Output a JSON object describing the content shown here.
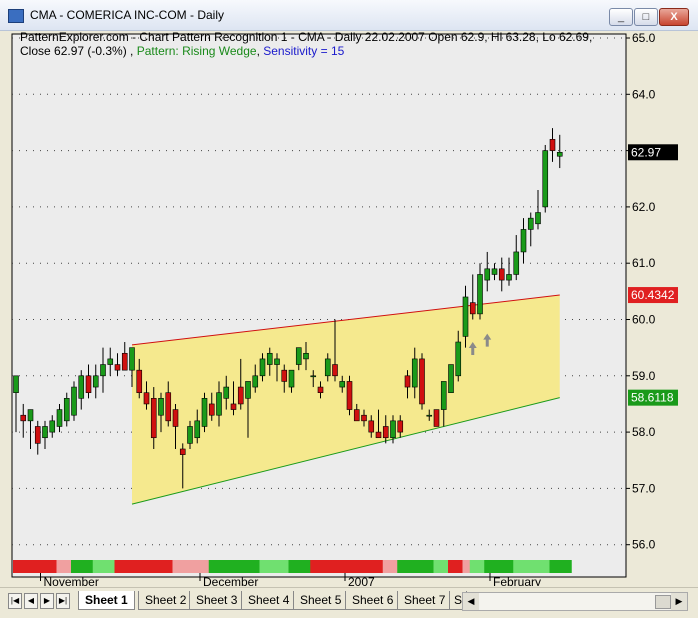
{
  "window": {
    "title": "CMA - COMERICA INC-COM - Daily",
    "min_label": "_",
    "max_label": "□",
    "close_label": "X"
  },
  "header": {
    "line1": "PatternExplorer.com - Chart Pattern Recognition 1  - CMA - Daily 22.02.2007 Open 62.9, Hi 63.28, Lo 62.69,",
    "close_text": "Close 62.97 (-0.3%) ,",
    "pattern_text": "Pattern: Rising Wedge",
    "sensitivity_text": "Sensitivity = 15"
  },
  "price_axis": {
    "labels": [
      "65.0",
      "64.0",
      "63.0",
      "62.0",
      "61.0",
      "60.0",
      "59.0",
      "58.0",
      "57.0",
      "56.0"
    ]
  },
  "value_badges": [
    {
      "text": "62.97",
      "value": 62.97,
      "bg": "#000000"
    },
    {
      "text": "60.4342",
      "value": 60.4342,
      "bg": "#e02020"
    },
    {
      "text": "58.6118",
      "value": 58.6118,
      "bg": "#1a9a1a"
    }
  ],
  "date_labels": [
    {
      "text": "November",
      "bar": 2
    },
    {
      "text": "December",
      "bar": 24
    },
    {
      "text": "2007",
      "bar": 44
    },
    {
      "text": "February",
      "bar": 64
    }
  ],
  "chart_data": {
    "type": "candlestick",
    "ylim": [
      55.8,
      65.1
    ],
    "candles": [
      {
        "o": 58.7,
        "h": 59.0,
        "l": 58.0,
        "c": 59.0
      },
      {
        "o": 58.3,
        "h": 58.5,
        "l": 57.9,
        "c": 58.2
      },
      {
        "o": 58.2,
        "h": 58.4,
        "l": 57.7,
        "c": 58.4
      },
      {
        "o": 58.1,
        "h": 58.2,
        "l": 57.6,
        "c": 57.8
      },
      {
        "o": 57.9,
        "h": 58.2,
        "l": 57.7,
        "c": 58.1
      },
      {
        "o": 58.0,
        "h": 58.3,
        "l": 57.9,
        "c": 58.2
      },
      {
        "o": 58.1,
        "h": 58.5,
        "l": 58.0,
        "c": 58.4
      },
      {
        "o": 58.2,
        "h": 58.7,
        "l": 58.1,
        "c": 58.6
      },
      {
        "o": 58.3,
        "h": 58.9,
        "l": 58.2,
        "c": 58.8
      },
      {
        "o": 58.6,
        "h": 59.1,
        "l": 58.4,
        "c": 59.0
      },
      {
        "o": 59.0,
        "h": 59.2,
        "l": 58.6,
        "c": 58.7
      },
      {
        "o": 58.8,
        "h": 59.2,
        "l": 58.6,
        "c": 59.0
      },
      {
        "o": 59.0,
        "h": 59.5,
        "l": 58.7,
        "c": 59.2
      },
      {
        "o": 59.2,
        "h": 59.5,
        "l": 59.0,
        "c": 59.3
      },
      {
        "o": 59.2,
        "h": 59.4,
        "l": 59.0,
        "c": 59.1
      },
      {
        "o": 59.4,
        "h": 59.6,
        "l": 59.1,
        "c": 59.1
      },
      {
        "o": 59.1,
        "h": 59.3,
        "l": 58.8,
        "c": 59.5
      },
      {
        "o": 59.1,
        "h": 59.3,
        "l": 58.6,
        "c": 58.7
      },
      {
        "o": 58.7,
        "h": 58.9,
        "l": 58.4,
        "c": 58.5
      },
      {
        "o": 58.6,
        "h": 58.8,
        "l": 57.7,
        "c": 57.9
      },
      {
        "o": 58.3,
        "h": 58.7,
        "l": 58.0,
        "c": 58.6
      },
      {
        "o": 58.7,
        "h": 58.9,
        "l": 58.1,
        "c": 58.2
      },
      {
        "o": 58.4,
        "h": 58.5,
        "l": 57.7,
        "c": 58.1
      },
      {
        "o": 57.7,
        "h": 57.8,
        "l": 57.0,
        "c": 57.6
      },
      {
        "o": 57.8,
        "h": 58.2,
        "l": 57.7,
        "c": 58.1
      },
      {
        "o": 57.9,
        "h": 58.4,
        "l": 57.8,
        "c": 58.2
      },
      {
        "o": 58.1,
        "h": 58.7,
        "l": 58.0,
        "c": 58.6
      },
      {
        "o": 58.5,
        "h": 58.7,
        "l": 58.2,
        "c": 58.3
      },
      {
        "o": 58.3,
        "h": 58.9,
        "l": 58.1,
        "c": 58.7
      },
      {
        "o": 58.6,
        "h": 59.0,
        "l": 58.4,
        "c": 58.8
      },
      {
        "o": 58.5,
        "h": 58.9,
        "l": 58.3,
        "c": 58.4
      },
      {
        "o": 58.8,
        "h": 59.3,
        "l": 58.4,
        "c": 58.5
      },
      {
        "o": 58.6,
        "h": 58.7,
        "l": 57.9,
        "c": 58.9
      },
      {
        "o": 58.8,
        "h": 59.2,
        "l": 58.7,
        "c": 59.0
      },
      {
        "o": 59.0,
        "h": 59.4,
        "l": 58.9,
        "c": 59.3
      },
      {
        "o": 59.2,
        "h": 59.5,
        "l": 59.0,
        "c": 59.4
      },
      {
        "o": 59.2,
        "h": 59.4,
        "l": 58.9,
        "c": 59.3
      },
      {
        "o": 59.1,
        "h": 59.2,
        "l": 58.7,
        "c": 58.9
      },
      {
        "o": 58.8,
        "h": 59.0,
        "l": 58.7,
        "c": 59.1
      },
      {
        "o": 59.2,
        "h": 59.5,
        "l": 59.1,
        "c": 59.5
      },
      {
        "o": 59.3,
        "h": 59.6,
        "l": 59.1,
        "c": 59.4
      },
      {
        "o": 59.0,
        "h": 59.1,
        "l": 58.8,
        "c": 59.0
      },
      {
        "o": 58.8,
        "h": 58.9,
        "l": 58.6,
        "c": 58.7
      },
      {
        "o": 59.0,
        "h": 59.4,
        "l": 58.9,
        "c": 59.3
      },
      {
        "o": 59.2,
        "h": 60.0,
        "l": 58.9,
        "c": 59.0
      },
      {
        "o": 58.8,
        "h": 59.0,
        "l": 58.7,
        "c": 58.9
      },
      {
        "o": 58.9,
        "h": 59.0,
        "l": 58.3,
        "c": 58.4
      },
      {
        "o": 58.4,
        "h": 58.5,
        "l": 58.2,
        "c": 58.2
      },
      {
        "o": 58.3,
        "h": 58.4,
        "l": 58.1,
        "c": 58.2
      },
      {
        "o": 58.2,
        "h": 58.3,
        "l": 57.9,
        "c": 58.0
      },
      {
        "o": 58.0,
        "h": 58.4,
        "l": 57.9,
        "c": 57.9
      },
      {
        "o": 58.1,
        "h": 58.3,
        "l": 57.8,
        "c": 57.9
      },
      {
        "o": 57.9,
        "h": 58.3,
        "l": 57.8,
        "c": 58.2
      },
      {
        "o": 58.2,
        "h": 58.3,
        "l": 57.9,
        "c": 58.0
      },
      {
        "o": 59.0,
        "h": 59.1,
        "l": 58.6,
        "c": 58.8
      },
      {
        "o": 58.8,
        "h": 59.5,
        "l": 58.6,
        "c": 59.3
      },
      {
        "o": 59.3,
        "h": 59.4,
        "l": 58.4,
        "c": 58.5
      },
      {
        "o": 58.3,
        "h": 58.4,
        "l": 58.2,
        "c": 58.3
      },
      {
        "o": 58.4,
        "h": 58.4,
        "l": 58.1,
        "c": 58.1
      },
      {
        "o": 58.4,
        "h": 58.9,
        "l": 58.1,
        "c": 58.9
      },
      {
        "o": 58.7,
        "h": 59.2,
        "l": 58.7,
        "c": 59.2
      },
      {
        "o": 59.0,
        "h": 59.8,
        "l": 58.9,
        "c": 59.6
      },
      {
        "o": 59.7,
        "h": 60.6,
        "l": 59.5,
        "c": 60.4
      },
      {
        "o": 60.3,
        "h": 60.8,
        "l": 60.0,
        "c": 60.1
      },
      {
        "o": 60.1,
        "h": 61.0,
        "l": 60.0,
        "c": 60.8
      },
      {
        "o": 60.7,
        "h": 61.2,
        "l": 60.5,
        "c": 60.9
      },
      {
        "o": 60.8,
        "h": 61.0,
        "l": 60.7,
        "c": 60.9
      },
      {
        "o": 60.9,
        "h": 61.1,
        "l": 60.5,
        "c": 60.7
      },
      {
        "o": 60.7,
        "h": 61.1,
        "l": 60.6,
        "c": 60.8
      },
      {
        "o": 60.8,
        "h": 61.5,
        "l": 60.7,
        "c": 61.2
      },
      {
        "o": 61.2,
        "h": 61.8,
        "l": 61.0,
        "c": 61.6
      },
      {
        "o": 61.6,
        "h": 61.9,
        "l": 61.3,
        "c": 61.8
      },
      {
        "o": 61.7,
        "h": 62.3,
        "l": 61.6,
        "c": 61.9
      },
      {
        "o": 62.0,
        "h": 63.1,
        "l": 61.9,
        "c": 63.0
      },
      {
        "o": 63.2,
        "h": 63.4,
        "l": 62.8,
        "c": 63.0
      },
      {
        "o": 62.9,
        "h": 63.28,
        "l": 62.69,
        "c": 62.97
      }
    ],
    "wedge": {
      "upper": {
        "start_bar": 16,
        "start_value": 59.55,
        "end_bar": 75,
        "end_value": 60.4342
      },
      "lower": {
        "start_bar": 16,
        "start_value": 56.72,
        "end_bar": 75,
        "end_value": 58.6118
      }
    },
    "arrows": [
      {
        "bar": 63,
        "value": 59.6
      },
      {
        "bar": 65,
        "value": 59.75
      }
    ],
    "strip": [
      "#e02020",
      "#e02020",
      "#e02020",
      "#e02020",
      "#e02020",
      "#e02020",
      "#f0a0a0",
      "#f0a0a0",
      "#20b020",
      "#20b020",
      "#20b020",
      "#70e070",
      "#70e070",
      "#70e070",
      "#e02020",
      "#e02020",
      "#e02020",
      "#e02020",
      "#e02020",
      "#e02020",
      "#e02020",
      "#e02020",
      "#f0a0a0",
      "#f0a0a0",
      "#f0a0a0",
      "#f0a0a0",
      "#f0a0a0",
      "#20b020",
      "#20b020",
      "#20b020",
      "#20b020",
      "#20b020",
      "#20b020",
      "#20b020",
      "#70e070",
      "#70e070",
      "#70e070",
      "#70e070",
      "#20b020",
      "#20b020",
      "#20b020",
      "#e02020",
      "#e02020",
      "#e02020",
      "#e02020",
      "#e02020",
      "#e02020",
      "#e02020",
      "#e02020",
      "#e02020",
      "#e02020",
      "#f0a0a0",
      "#f0a0a0",
      "#20b020",
      "#20b020",
      "#20b020",
      "#20b020",
      "#20b020",
      "#70e070",
      "#70e070",
      "#e02020",
      "#e02020",
      "#f0a0a0",
      "#70e070",
      "#70e070",
      "#20b020",
      "#20b020",
      "#20b020",
      "#20b020",
      "#70e070",
      "#70e070",
      "#70e070",
      "#70e070",
      "#70e070",
      "#20b020",
      "#20b020",
      "#20b020"
    ]
  },
  "tabs": [
    "Sheet 1",
    "Sheet 2",
    "Sheet 3",
    "Sheet 4",
    "Sheet 5",
    "Sheet 6",
    "Sheet 7",
    "S"
  ],
  "nav": {
    "first": "|◀",
    "prev": "◀",
    "next": "▶",
    "last": "▶|"
  }
}
